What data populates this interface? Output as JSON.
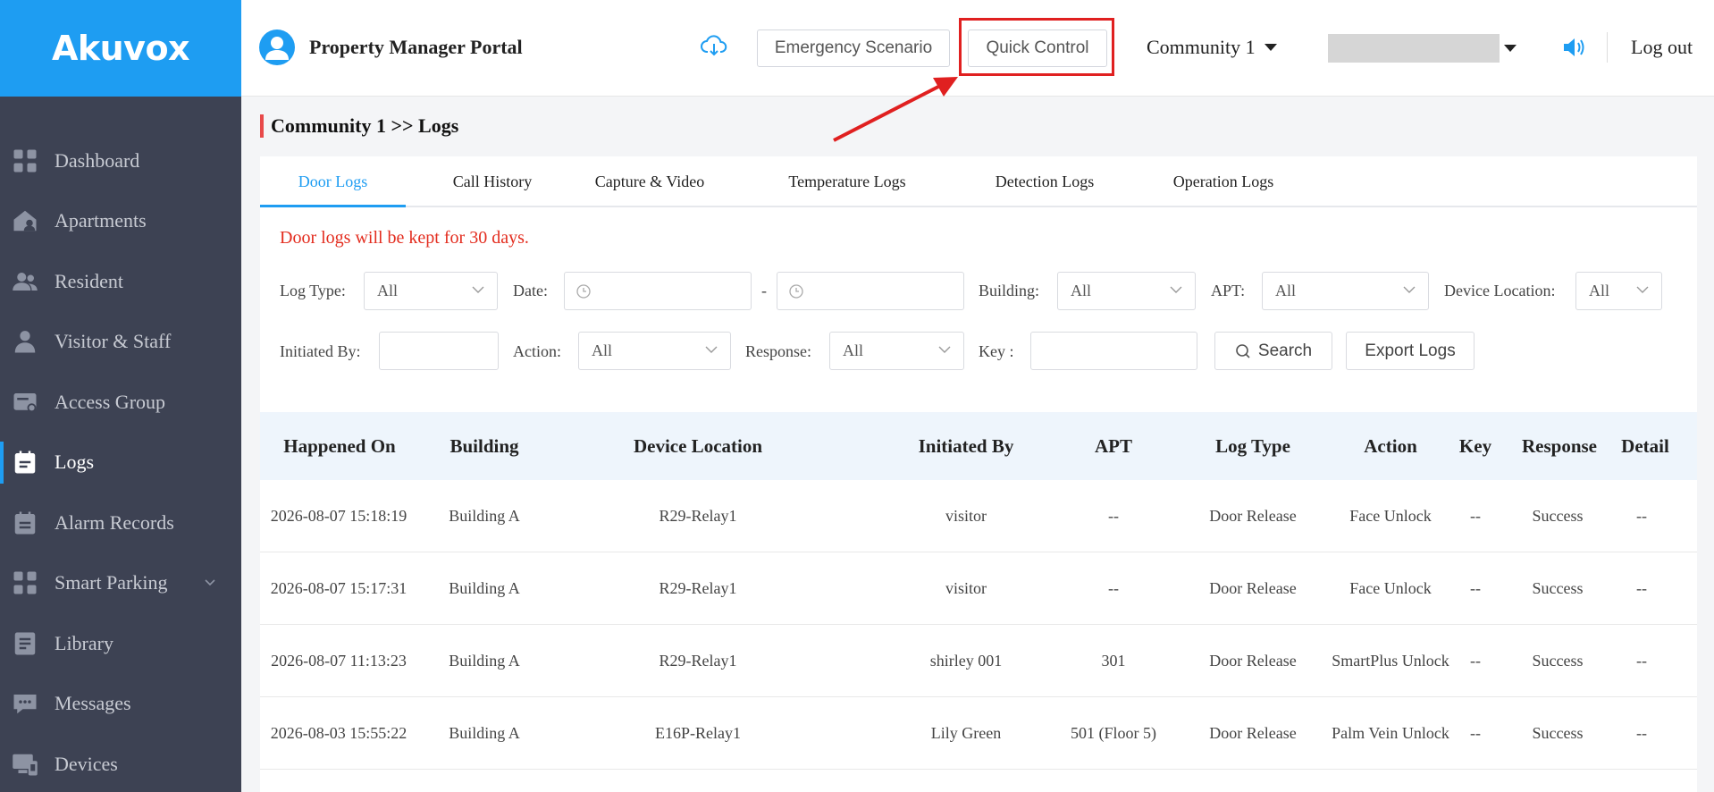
{
  "brand": {
    "logo_text": "Akuvox"
  },
  "sidebar": {
    "items": [
      {
        "label": "Dashboard",
        "icon": "dashboard-icon",
        "active": false
      },
      {
        "label": "Apartments",
        "icon": "apartments-icon",
        "active": false
      },
      {
        "label": "Resident",
        "icon": "resident-icon",
        "active": false
      },
      {
        "label": "Visitor & Staff",
        "icon": "visitor-icon",
        "active": false
      },
      {
        "label": "Access Group",
        "icon": "access-group-icon",
        "active": false
      },
      {
        "label": "Logs",
        "icon": "logs-icon",
        "active": true
      },
      {
        "label": "Alarm Records",
        "icon": "alarm-icon",
        "active": false
      },
      {
        "label": "Smart Parking",
        "icon": "parking-icon",
        "active": false,
        "expandable": true
      },
      {
        "label": "Library",
        "icon": "library-icon",
        "active": false
      },
      {
        "label": "Messages",
        "icon": "messages-icon",
        "active": false
      },
      {
        "label": "Devices",
        "icon": "devices-icon",
        "active": false
      }
    ]
  },
  "header": {
    "title": "Property Manager Portal",
    "emergency_label": "Emergency Scenario",
    "quick_control_label": "Quick Control",
    "community": "Community 1",
    "logout_label": "Log out"
  },
  "breadcrumb": "Community 1 >>  Logs",
  "tabs": [
    {
      "label": "Door Logs",
      "active": true
    },
    {
      "label": "Call History",
      "active": false
    },
    {
      "label": "Capture & Video",
      "active": false
    },
    {
      "label": "Temperature Logs",
      "active": false
    },
    {
      "label": "Detection Logs",
      "active": false
    },
    {
      "label": "Operation Logs",
      "active": false
    }
  ],
  "notice": "Door logs will be kept for 30 days.",
  "filters": {
    "log_type": {
      "label": "Log Type:",
      "value": "All"
    },
    "date": {
      "label": "Date:",
      "separator": "-"
    },
    "building": {
      "label": "Building:",
      "value": "All"
    },
    "apt": {
      "label": "APT:",
      "value": "All"
    },
    "device_location": {
      "label": "Device Location:",
      "value": "All"
    },
    "initiated_by": {
      "label": "Initiated By:",
      "value": ""
    },
    "action": {
      "label": "Action:",
      "value": "All"
    },
    "response": {
      "label": "Response:",
      "value": "All"
    },
    "key": {
      "label": "Key :",
      "value": ""
    },
    "search_label": "Search",
    "export_label": "Export Logs"
  },
  "table": {
    "columns": [
      "Happened On",
      "Building",
      "Device Location",
      "Initiated By",
      "APT",
      "Log Type",
      "Action",
      "Key",
      "Response",
      "Detail"
    ],
    "rows": [
      [
        "2026-08-07 15:18:19",
        "Building A",
        "R29-Relay1",
        "visitor",
        "--",
        "Door Release",
        "Face Unlock",
        "--",
        "Success",
        "--"
      ],
      [
        "2026-08-07 15:17:31",
        "Building A",
        "R29-Relay1",
        "visitor",
        "--",
        "Door Release",
        "Face Unlock",
        "--",
        "Success",
        "--"
      ],
      [
        "2026-08-07 11:13:23",
        "Building A",
        "R29-Relay1",
        "shirley 001",
        "301",
        "Door Release",
        "SmartPlus Unlock",
        "--",
        "Success",
        "--"
      ],
      [
        "2026-08-03 15:55:22",
        "Building A",
        "E16P-Relay1",
        "Lily Green",
        "501 (Floor 5)",
        "Door Release",
        "Palm Vein Unlock",
        "--",
        "Success",
        "--"
      ]
    ]
  },
  "colors": {
    "brand_blue": "#1e9df2",
    "sidebar_bg": "#3d4253",
    "highlight_red": "#e02020",
    "notice_red": "#e32c1e"
  }
}
